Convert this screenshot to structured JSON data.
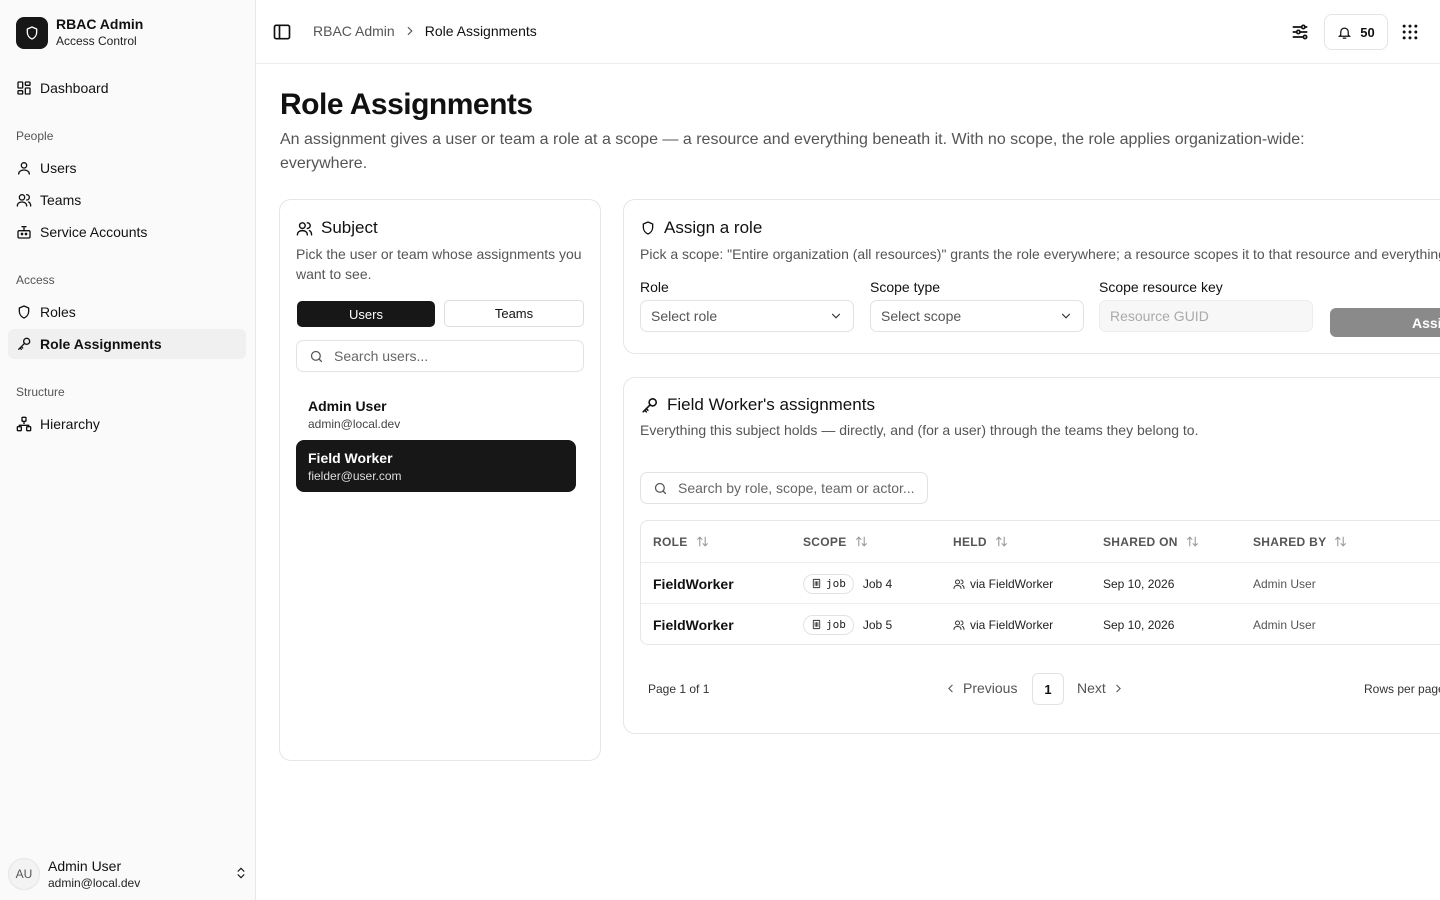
{
  "brand": {
    "title": "RBAC Admin",
    "subtitle": "Access Control"
  },
  "sidebar": {
    "dashboard": "Dashboard",
    "groups": {
      "people": "People",
      "access": "Access",
      "structure": "Structure"
    },
    "items": {
      "users": "Users",
      "teams": "Teams",
      "service_accounts": "Service Accounts",
      "roles": "Roles",
      "role_assignments": "Role Assignments",
      "hierarchy": "Hierarchy"
    },
    "active": "Role Assignments"
  },
  "footer_user": {
    "initials": "AU",
    "name": "Admin User",
    "email": "admin@local.dev"
  },
  "topbar": {
    "breadcrumb": [
      "RBAC Admin",
      "Role Assignments"
    ],
    "notification_count": "50"
  },
  "page": {
    "title": "Role Assignments",
    "description": "An assignment gives a user or team a role at a scope — a resource and everything beneath it. With no scope, the role applies organization-wide: everywhere."
  },
  "subject_card": {
    "title": "Subject",
    "description": "Pick the user or team whose assignments you want to see.",
    "toggle": {
      "users": "Users",
      "teams": "Teams",
      "selected": "Users"
    },
    "search_placeholder": "Search users...",
    "subjects": [
      {
        "name": "Admin User",
        "email": "admin@local.dev",
        "selected": false
      },
      {
        "name": "Field Worker",
        "email": "fielder@user.com",
        "selected": true
      }
    ]
  },
  "assign_card": {
    "title": "Assign a role",
    "description": "Pick a scope: \"Entire organization (all resources)\" grants the role everywhere; a resource scopes it to that resource and everything beneath it.",
    "role_label": "Role",
    "role_placeholder": "Select role",
    "scope_type_label": "Scope type",
    "scope_type_placeholder": "Select scope",
    "scope_key_label": "Scope resource key",
    "scope_key_placeholder": "Resource GUID",
    "button": "Assign"
  },
  "assignments_card": {
    "title": "Field Worker's assignments",
    "description": "Everything this subject holds — directly, and (for a user) through the teams they belong to.",
    "search_placeholder": "Search by role, scope, team or actor...",
    "columns": [
      "ROLE",
      "SCOPE",
      "HELD",
      "SHARED ON",
      "SHARED BY"
    ],
    "rows": [
      {
        "role": "FieldWorker",
        "scope_type": "job",
        "scope_name": "Job 4",
        "held": "via FieldWorker",
        "shared_on": "Sep 10, 2026",
        "shared_by": "Admin User"
      },
      {
        "role": "FieldWorker",
        "scope_type": "job",
        "scope_name": "Job 5",
        "held": "via FieldWorker",
        "shared_on": "Sep 10, 2026",
        "shared_by": "Admin User"
      }
    ],
    "pagination": {
      "page_text": "Page 1 of 1",
      "previous": "Previous",
      "current": "1",
      "next": "Next",
      "rows_per_page": "Rows per page"
    }
  }
}
